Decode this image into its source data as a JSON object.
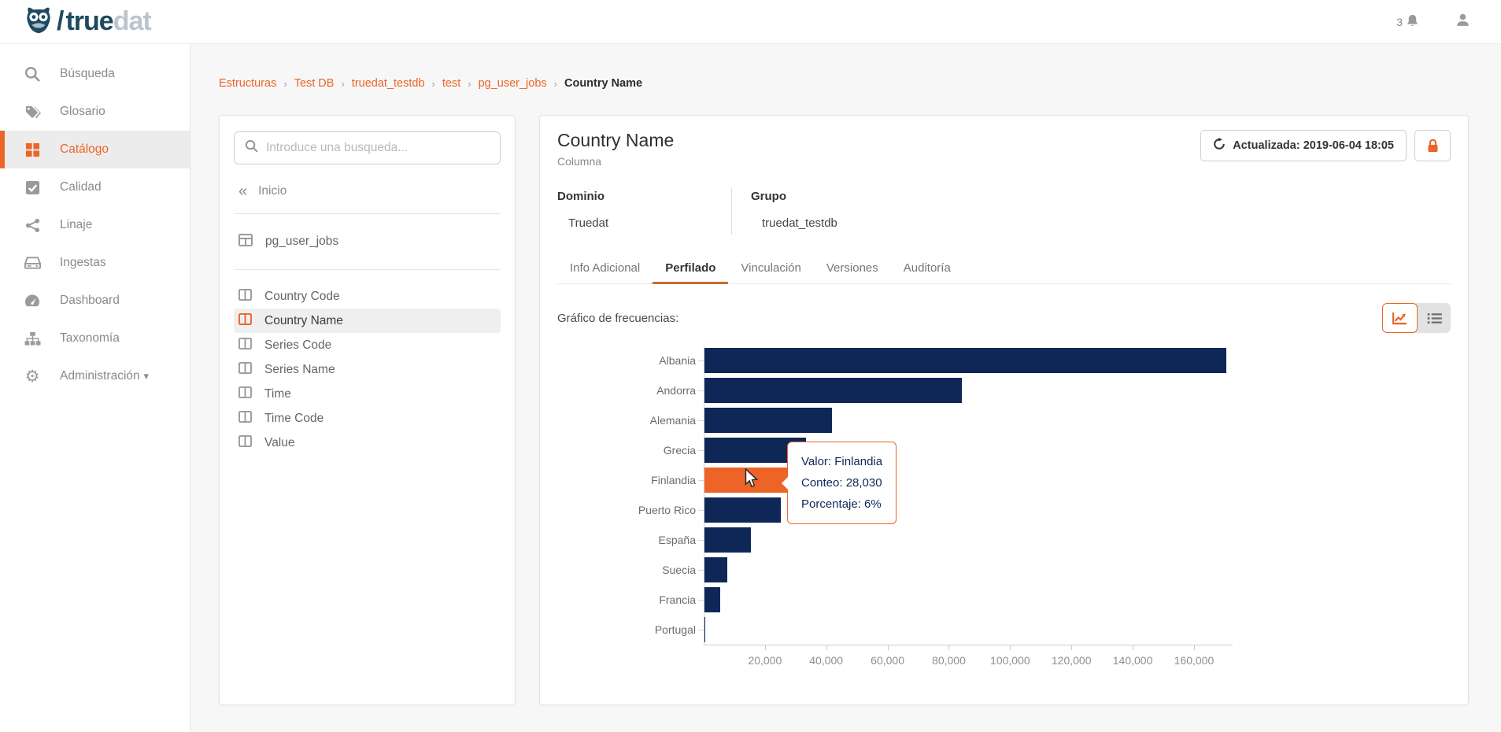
{
  "topbar": {
    "brand": {
      "slash": "/",
      "name_primary": "true",
      "name_secondary": "dat"
    },
    "notifications": {
      "count": "3"
    }
  },
  "breadcrumb": {
    "links": [
      "Estructuras",
      "Test DB",
      "truedat_testdb",
      "test",
      "pg_user_jobs"
    ],
    "current": "Country Name",
    "separator": "›"
  },
  "sidebar": {
    "items": [
      {
        "label": "Búsqueda",
        "icon": "search-icon",
        "active": false
      },
      {
        "label": "Glosario",
        "icon": "tags-icon",
        "active": false
      },
      {
        "label": "Catálogo",
        "icon": "grid-icon",
        "active": true
      },
      {
        "label": "Calidad",
        "icon": "check-square-icon",
        "active": false
      },
      {
        "label": "Linaje",
        "icon": "share-icon",
        "active": false
      },
      {
        "label": "Ingestas",
        "icon": "drive-icon",
        "active": false
      },
      {
        "label": "Dashboard",
        "icon": "gauge-icon",
        "active": false
      },
      {
        "label": "Taxonomía",
        "icon": "sitemap-icon",
        "active": false
      },
      {
        "label": "Administración",
        "icon": "gear-icon",
        "active": false,
        "has_caret": true
      }
    ]
  },
  "structure_panel": {
    "search_placeholder": "Introduce una busqueda...",
    "back_label": "Inicio",
    "table_name": "pg_user_jobs",
    "columns": [
      "Country Code",
      "Country Name",
      "Series Code",
      "Series Name",
      "Time",
      "Time Code",
      "Value"
    ],
    "selected_column": "Country Name"
  },
  "main": {
    "title": "Country Name",
    "subtitle": "Columna",
    "updated_button": "Actualizada: 2019-06-04 18:05",
    "meta": {
      "domain_label": "Dominio",
      "domain_value": "Truedat",
      "group_label": "Grupo",
      "group_value": "truedat_testdb"
    },
    "tabs": [
      "Info Adicional",
      "Perfilado",
      "Vinculación",
      "Versiones",
      "Auditoría"
    ],
    "active_tab": "Perfilado",
    "chart_heading": "Gráfico de frecuencias:"
  },
  "chart_data": {
    "type": "bar",
    "orientation": "horizontal",
    "title": "Gráfico de frecuencias",
    "categories": [
      "Albania",
      "Andorra",
      "Alemania",
      "Grecia",
      "Finlandia",
      "Puerto Rico",
      "España",
      "Suecia",
      "Francia",
      "Portugal"
    ],
    "values": [
      170600,
      84300,
      41800,
      33300,
      28030,
      25200,
      15400,
      7700,
      5400,
      600
    ],
    "highlight_category": "Finlandia",
    "bar_color": "#0E2757",
    "highlight_color": "#EC6427",
    "x_ticks": [
      20000,
      40000,
      60000,
      80000,
      100000,
      120000,
      140000,
      160000
    ],
    "x_tick_labels": [
      "20,000",
      "40,000",
      "60,000",
      "80,000",
      "100,000",
      "120,000",
      "140,000",
      "160,000"
    ],
    "xlim": [
      0,
      172600
    ],
    "grid": false,
    "legend": false,
    "tooltip": {
      "lines": [
        "Valor: Finlandia",
        "Conteo: 28,030",
        "Porcentaje: 6%"
      ]
    }
  },
  "colors": {
    "accent": "#EC6427",
    "bar_navy": "#0E2757",
    "brand_primary": "#1D4A5F",
    "brand_secondary": "#B9C6CF"
  }
}
